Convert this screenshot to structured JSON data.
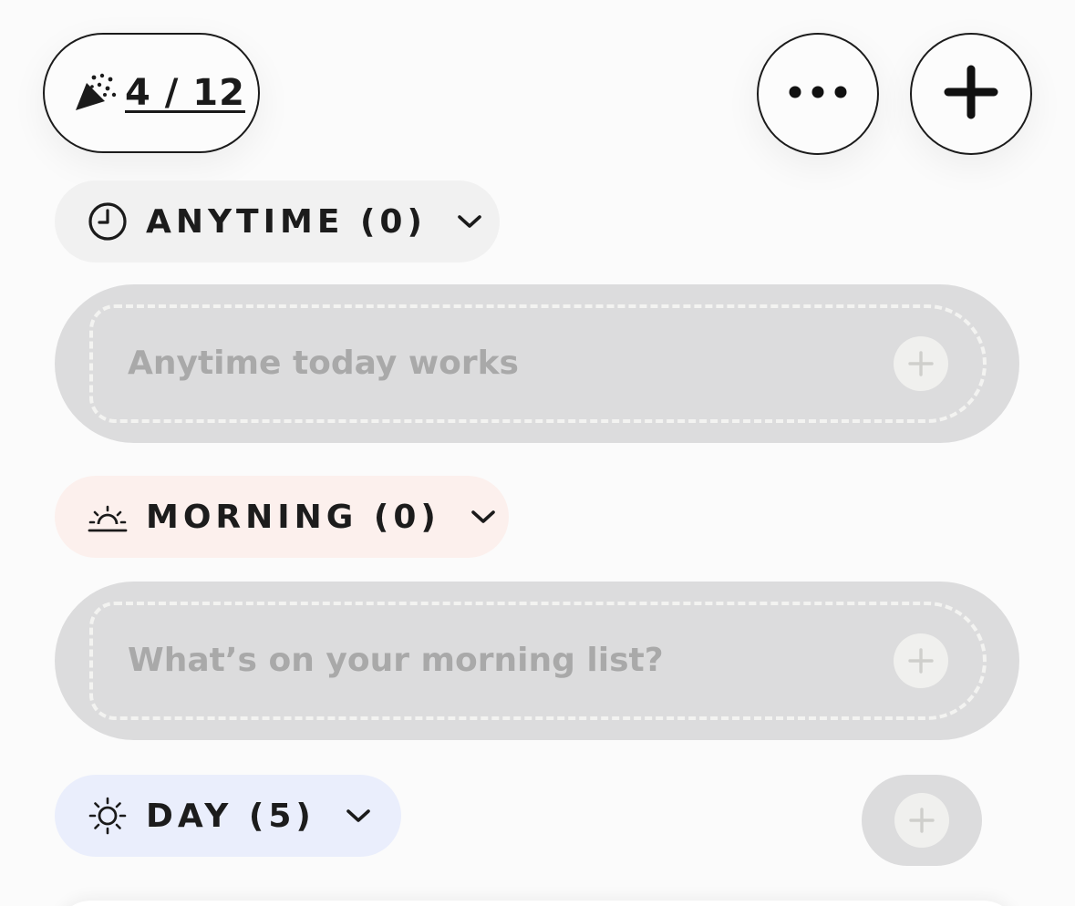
{
  "header": {
    "progress": "4 / 12",
    "party_icon": "party-popper-icon",
    "more_icon": "more-horizontal-icon",
    "add_icon": "plus-icon"
  },
  "sections": {
    "anytime": {
      "label": "ANYTIME (0)",
      "icon": "clock-icon",
      "color": "#f1f1f1",
      "placeholder": "Anytime today works"
    },
    "morning": {
      "label": "MORNING (0)",
      "icon": "sunrise-icon",
      "color": "#fcf0ed",
      "placeholder": "What’s on your morning list?"
    },
    "day": {
      "label": "DAY (5)",
      "icon": "sun-icon",
      "color": "#eaeefc"
    }
  }
}
